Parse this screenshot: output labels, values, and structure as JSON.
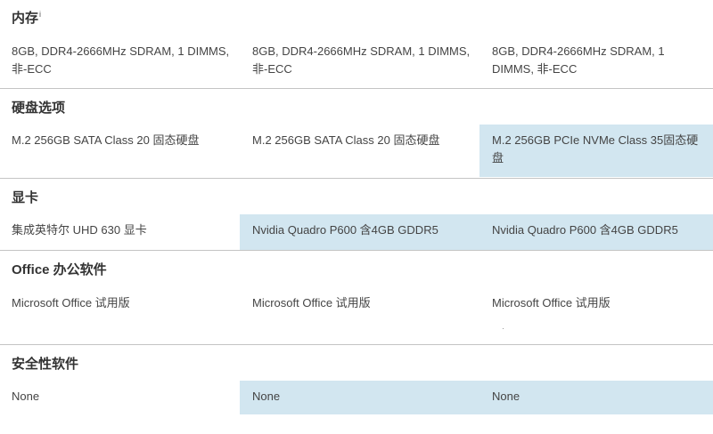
{
  "memory": {
    "title": "内存",
    "info_mark": "i",
    "values": [
      "8GB, DDR4-2666MHz SDRAM, 1 DIMMS, 非-ECC",
      "8GB, DDR4-2666MHz SDRAM, 1 DIMMS, 非-ECC",
      "8GB, DDR4-2666MHz SDRAM, 1 DIMMS, 非-ECC"
    ]
  },
  "storage": {
    "title": "硬盘选项",
    "values": [
      "M.2 256GB SATA Class 20 固态硬盘",
      "M.2 256GB SATA Class 20 固态硬盘",
      "M.2 256GB PCIe NVMe Class 35固态硬盘"
    ],
    "highlighted": [
      false,
      false,
      true
    ]
  },
  "graphics": {
    "title": "显卡",
    "values": [
      "集成英特尔 UHD 630 显卡",
      "Nvidia Quadro P600 含4GB GDDR5",
      "Nvidia Quadro P600 含4GB GDDR5"
    ],
    "highlighted": [
      false,
      true,
      true
    ]
  },
  "office": {
    "title": "Office 办公软件",
    "values": [
      "Microsoft Office 试用版",
      "Microsoft Office 试用版",
      "Microsoft Office 试用版"
    ],
    "highlighted": [
      false,
      false,
      false
    ]
  },
  "security": {
    "title": "安全性软件",
    "values": [
      "None",
      "None",
      "None"
    ],
    "highlighted": [
      false,
      true,
      true
    ]
  },
  "colors": {
    "highlight": "#d2e6f0",
    "divider": "#c4c4c4",
    "text": "#444444"
  }
}
